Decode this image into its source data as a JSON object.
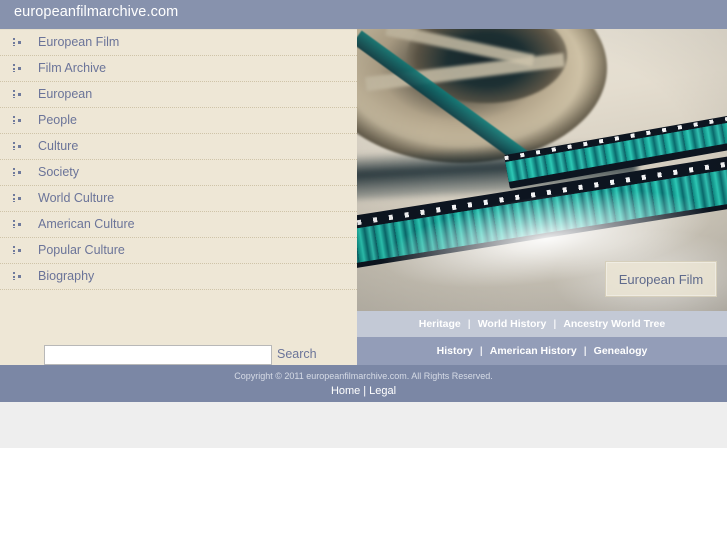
{
  "header": {
    "title": "europeanfilmarchive.com",
    "background_color": "#8792ad",
    "text_color": "#ffffff"
  },
  "keywords": {
    "background_color": "#eee7d6",
    "link_color": "#6b7499",
    "bullet_icon": "dots-bullet-icon",
    "items": [
      {
        "label": "European Film"
      },
      {
        "label": "Film Archive"
      },
      {
        "label": "European"
      },
      {
        "label": "People"
      },
      {
        "label": "Culture"
      },
      {
        "label": "Society"
      },
      {
        "label": "World Culture"
      },
      {
        "label": "American Culture"
      },
      {
        "label": "Popular Culture"
      },
      {
        "label": "Biography"
      }
    ]
  },
  "search": {
    "value": "",
    "placeholder": "",
    "button_label": "Search"
  },
  "hero": {
    "caption": "European Film",
    "image_description": "film-reel-photo"
  },
  "nav_primary": {
    "background_color": "#c3c9d6",
    "items": [
      {
        "label": "Heritage"
      },
      {
        "label": "World History"
      },
      {
        "label": "Ancestry World Tree"
      }
    ],
    "separator": "|"
  },
  "nav_secondary": {
    "background_color": "#939db8",
    "items": [
      {
        "label": "History"
      },
      {
        "label": "American History"
      },
      {
        "label": "Genealogy"
      }
    ],
    "separator": "|"
  },
  "footer": {
    "background_color": "#7b87a5",
    "copyright": "Copyright © 2011 europeanfilmarchive.com. All Rights Reserved.",
    "links": [
      {
        "label": "Home"
      },
      {
        "label": "Legal"
      }
    ],
    "separator": "|"
  }
}
